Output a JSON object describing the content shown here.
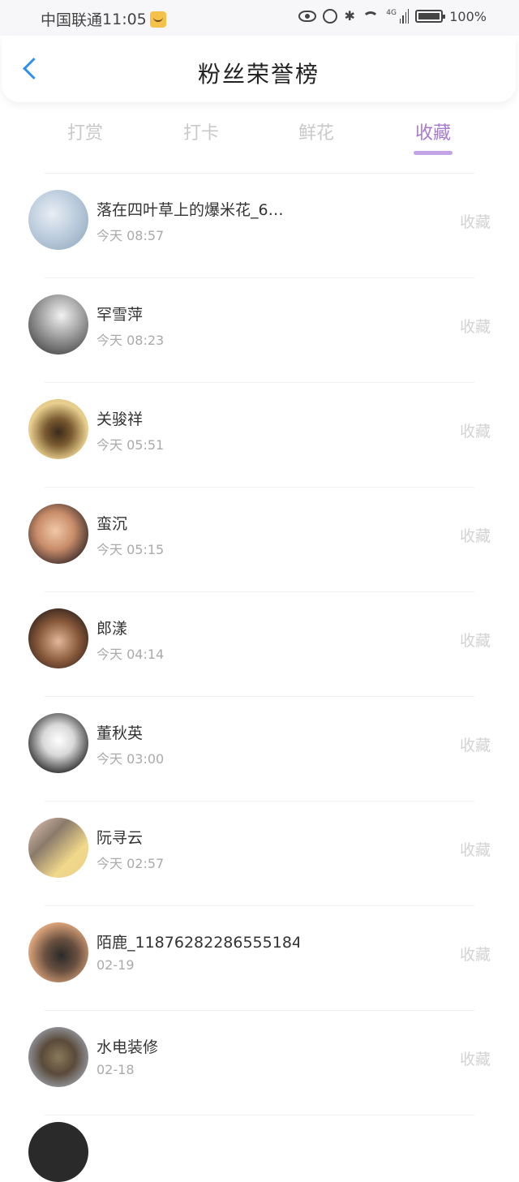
{
  "status_bar": {
    "carrier": "中国联通",
    "time": "11:05",
    "network": "4G",
    "battery": "100%"
  },
  "header": {
    "title": "粉丝荣誉榜"
  },
  "tabs": [
    {
      "label": "打赏",
      "active": false
    },
    {
      "label": "打卡",
      "active": false
    },
    {
      "label": "鲜花",
      "active": false
    },
    {
      "label": "收藏",
      "active": true
    }
  ],
  "colors": {
    "accent_purple": "#a77ad2",
    "back_blue": "#2f8ff0"
  },
  "fans": [
    {
      "name": "落在四叶草上的爆米花_6…",
      "time": "今天 08:57",
      "tag": "收藏"
    },
    {
      "name": "罕雪萍",
      "time": "今天 08:23",
      "tag": "收藏"
    },
    {
      "name": "关骏祥",
      "time": "今天 05:51",
      "tag": "收藏"
    },
    {
      "name": "蛮沉",
      "time": "今天 05:15",
      "tag": "收藏"
    },
    {
      "name": "郎漾",
      "time": "今天 04:14",
      "tag": "收藏"
    },
    {
      "name": "董秋英",
      "time": "今天 03:00",
      "tag": "收藏"
    },
    {
      "name": "阮寻云",
      "time": "今天 02:57",
      "tag": "收藏"
    },
    {
      "name": "陌鹿_1187628228655518​4",
      "time": "02-19",
      "tag": "收藏"
    },
    {
      "name": "水电装修",
      "time": "02-18",
      "tag": "收藏"
    }
  ]
}
